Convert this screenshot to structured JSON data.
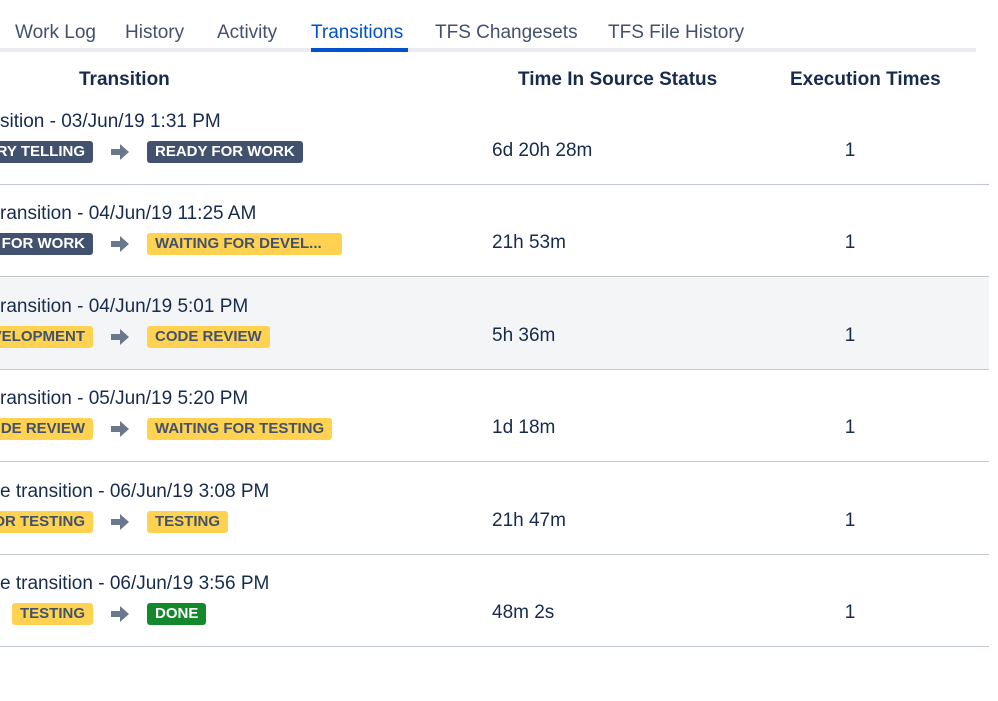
{
  "tabs": [
    {
      "label": "Work Log",
      "active": false
    },
    {
      "label": "History",
      "active": false
    },
    {
      "label": "Activity",
      "active": false
    },
    {
      "label": "Transitions",
      "active": true
    },
    {
      "label": "TFS Changesets",
      "active": false
    },
    {
      "label": "TFS File History",
      "active": false
    }
  ],
  "table": {
    "headers": {
      "transition": "Transition",
      "time_in_source": "Time In Source Status",
      "execution_times": "Execution Times"
    },
    "rows": [
      {
        "title": "sition - 03/Jun/19 1:31 PM",
        "from": "RY TELLING",
        "to": "READY FOR WORK",
        "time": "6d 20h 28m",
        "executions": "1"
      },
      {
        "title": "ransition - 04/Jun/19 11:25 AM",
        "from": "FOR WORK",
        "to": "WAITING FOR DEVEL...",
        "time": "21h 53m",
        "executions": "1"
      },
      {
        "title": "ransition - 04/Jun/19 5:01 PM",
        "from": "VELOPMENT",
        "to": "CODE REVIEW",
        "time": "5h 36m",
        "executions": "1"
      },
      {
        "title": "ransition - 05/Jun/19 5:20 PM",
        "from": "DE REVIEW",
        "to": "WAITING FOR TESTING",
        "time": "1d 18m",
        "executions": "1"
      },
      {
        "title": "e transition - 06/Jun/19 3:08 PM",
        "from": "OR TESTING",
        "to": "TESTING",
        "time": "21h 47m",
        "executions": "1"
      },
      {
        "title": "e transition - 06/Jun/19 3:56 PM",
        "from": "TESTING",
        "to": "DONE",
        "time": "48m 2s",
        "executions": "1"
      }
    ]
  },
  "status_colors": {
    "blue_gray": "#42526e",
    "yellow": "#ffd351",
    "green": "#14892c",
    "active_tab": "#0052cc"
  },
  "icons": {
    "transition_arrow": "arrow-right-icon"
  }
}
